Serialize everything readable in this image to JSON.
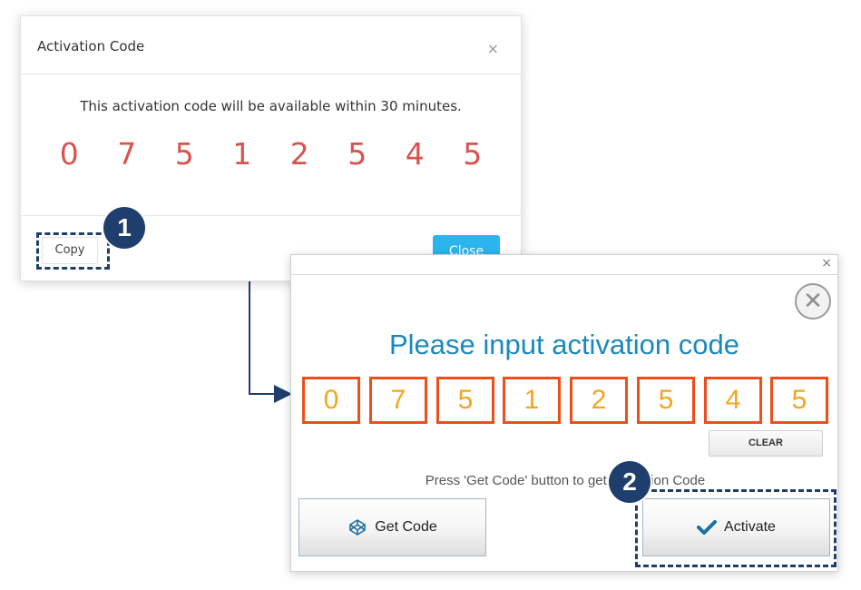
{
  "dialog1": {
    "title": "Activation Code",
    "close_glyph": "×",
    "message": "This activation code will be available within 30 minutes.",
    "code": "0 7 5 1 2 5 4 5",
    "copy_label": "Copy",
    "close_label": "Close",
    "accent_color": "#2bb5ef",
    "code_color": "#d9534f"
  },
  "callouts": {
    "step1": "1",
    "step2": "2",
    "color": "#1e3e6e"
  },
  "dialog2": {
    "titlebar_close": "×",
    "circle_close": "✕",
    "heading": "Please input activation code",
    "digits": [
      "0",
      "7",
      "5",
      "1",
      "2",
      "5",
      "4",
      "5"
    ],
    "clear_label": "CLEAR",
    "hint": "Press 'Get Code' button to get Activation Code",
    "get_code_label": "Get Code",
    "get_code_icon": "codepen-icon",
    "activate_label": "Activate",
    "activate_icon": "checkmark-icon",
    "heading_color": "#1b89bd",
    "digit_border_color": "#ed4f1c",
    "digit_text_color": "#f3a51c"
  }
}
